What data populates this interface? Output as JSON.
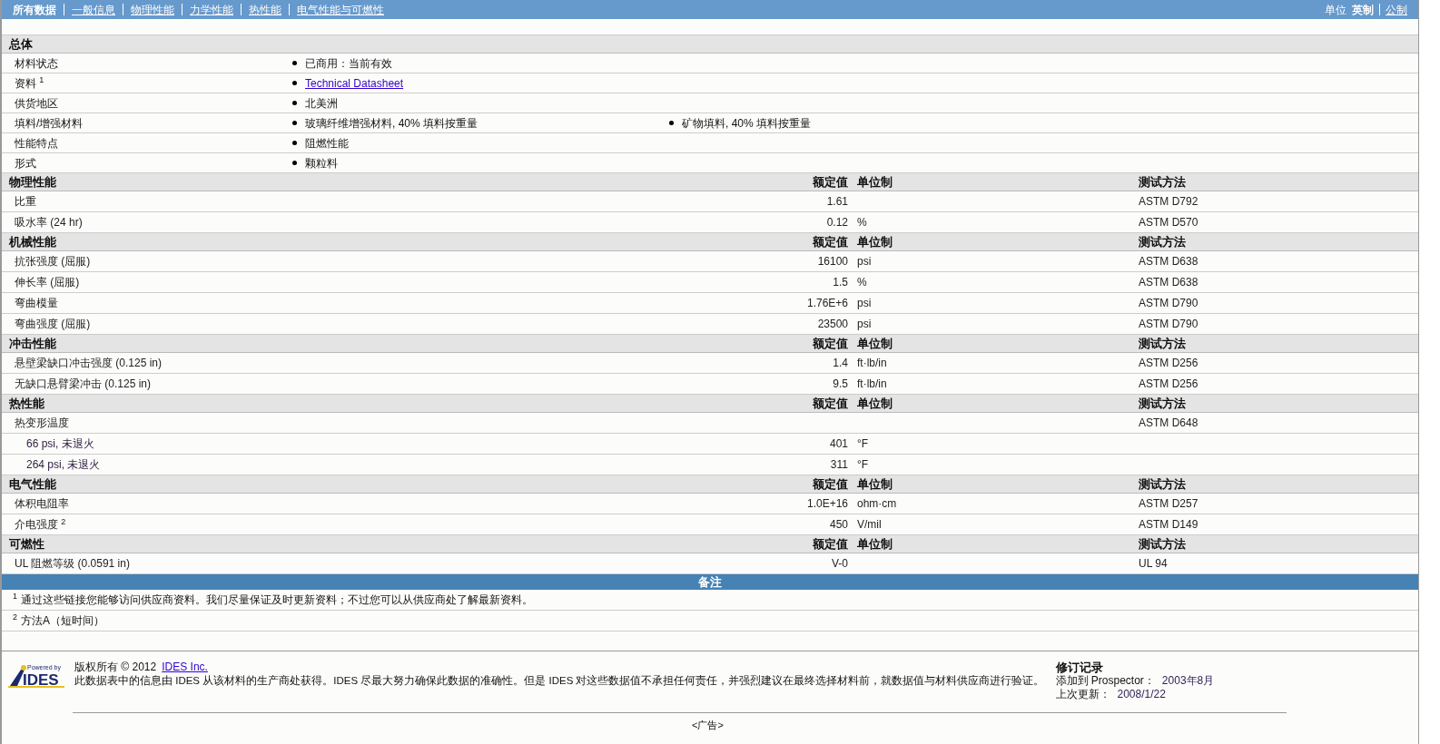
{
  "nav": {
    "tabs": [
      {
        "label": "所有数据",
        "selected": true
      },
      {
        "label": "一般信息",
        "selected": false
      },
      {
        "label": "物理性能",
        "selected": false
      },
      {
        "label": "力学性能",
        "selected": false
      },
      {
        "label": "热性能",
        "selected": false
      },
      {
        "label": "电气性能与可燃性",
        "selected": false
      }
    ],
    "units_label": "单位",
    "units": [
      {
        "label": "英制",
        "selected": true
      },
      {
        "label": "公制",
        "selected": false
      }
    ]
  },
  "general": {
    "title": "总体",
    "rows": [
      {
        "label": "材料状态",
        "values": [
          {
            "kind": "text",
            "text": "已商用：当前有效"
          }
        ]
      },
      {
        "label": "资料 $^{1}$",
        "values": [
          {
            "kind": "link",
            "text": "Technical Datasheet"
          }
        ]
      },
      {
        "label": "供货地区",
        "values": [
          {
            "kind": "text",
            "text": "北美洲"
          }
        ]
      },
      {
        "label": "填料/增强材料",
        "values": [
          {
            "kind": "text",
            "text": "玻璃纤维增强材料, 40% 填料按重量"
          },
          {
            "kind": "text",
            "text": "矿物填料, 40% 填料按重量"
          }
        ]
      },
      {
        "label": "性能特点",
        "values": [
          {
            "kind": "text",
            "text": "阻燃性能"
          }
        ]
      },
      {
        "label": "形式",
        "values": [
          {
            "kind": "text",
            "text": "颗粒料"
          }
        ]
      }
    ]
  },
  "sections": [
    {
      "title": "物理性能",
      "value_header": "额定值",
      "unit_header": "单位制",
      "method_header": "测试方法",
      "rows": [
        {
          "label": "比重",
          "value": "1.61",
          "method": "ASTM D792"
        },
        {
          "label": "吸水率 (24 hr)",
          "value": "0.12",
          "unit": "%",
          "method": "ASTM D570"
        }
      ]
    },
    {
      "title": "机械性能",
      "value_header": "额定值",
      "unit_header": "单位制",
      "method_header": "测试方法",
      "rows": [
        {
          "label": "抗张强度 (屈服)",
          "value": "16100",
          "unit": "psi",
          "method": "ASTM D638"
        },
        {
          "label": "伸长率 (屈服)",
          "value": "1.5",
          "unit": "%",
          "method": "ASTM D638"
        },
        {
          "label": "弯曲模量",
          "value": "1.76E+6",
          "unit": "psi",
          "method": "ASTM D790"
        },
        {
          "label": "弯曲强度 (屈服)",
          "value": "23500",
          "unit": "psi",
          "method": "ASTM D790"
        }
      ]
    },
    {
      "title": "冲击性能",
      "value_header": "额定值",
      "unit_header": "单位制",
      "method_header": "测试方法",
      "rows": [
        {
          "label": "悬壁梁缺口冲击强度 (0.125 in)",
          "value": "1.4",
          "unit": "ft·lb/in",
          "method": "ASTM D256"
        },
        {
          "label": "无缺口悬臂梁冲击 (0.125 in)",
          "value": "9.5",
          "unit": "ft·lb/in",
          "method": "ASTM D256"
        }
      ]
    },
    {
      "title": "热性能",
      "value_header": "额定值",
      "unit_header": "单位制",
      "method_header": "测试方法",
      "rows": [
        {
          "label": "热变形温度",
          "method": "ASTM D648",
          "children": [
            {
              "label": "66 psi, 未退火",
              "value": "401",
              "unit": "°F"
            },
            {
              "label": "264 psi, 未退火",
              "value": "311",
              "unit": "°F"
            }
          ]
        }
      ]
    },
    {
      "title": "电气性能",
      "value_header": "额定值",
      "unit_header": "单位制",
      "method_header": "测试方法",
      "rows": [
        {
          "label": "体积电阻率",
          "value": "1.0E+16",
          "unit": "ohm·cm",
          "method": "ASTM D257"
        },
        {
          "label": "介电强度 $^{2}$",
          "value": "450",
          "unit": "V/mil",
          "method": "ASTM D149"
        }
      ]
    },
    {
      "title": "可燃性",
      "value_header": "额定值",
      "unit_header": "单位制",
      "method_header": "测试方法",
      "rows": [
        {
          "label": "UL 阻燃等级 (0.0591 in)",
          "value": "V-0",
          "method": "UL 94"
        }
      ]
    }
  ],
  "notes": {
    "title": "备注",
    "items": [
      {
        "mark": "1",
        "text": "通过这些链接您能够访问供应商资料。我们尽量保证及时更新资料；不过您可以从供应商处了解最新资料。"
      },
      {
        "mark": "2",
        "text": "方法A（短时间）"
      }
    ]
  },
  "footer": {
    "logo": {
      "tagline": "Powered by",
      "name": "IDES"
    },
    "copyright": "版权所有 © 2012",
    "company_link": "IDES Inc.",
    "disclaimer": "此数据表中的信息由 IDES 从该材料的生产商处获得。IDES 尽最大努力确保此数据的准确性。但是 IDES 对这些数据值不承担任何责任，并强烈建议在最终选择材料前，就数据值与材料供应商进行验证。",
    "revision": {
      "title": "修订记录",
      "added_label": "添加到 Prospector：",
      "added": "2003年8月",
      "updated_label": "上次更新：",
      "updated": "2008/1/22"
    }
  },
  "ad": "<广告>"
}
